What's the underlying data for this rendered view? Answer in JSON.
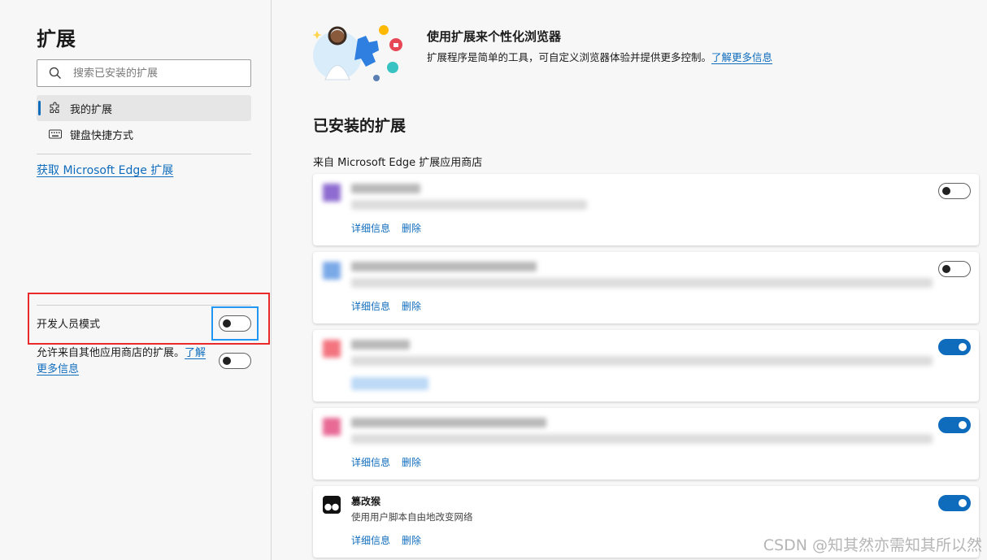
{
  "sidebar": {
    "title": "扩展",
    "search_placeholder": "搜索已安装的扩展",
    "nav": [
      {
        "label": "我的扩展",
        "icon": "puzzle-icon",
        "active": true
      },
      {
        "label": "键盘快捷方式",
        "icon": "keyboard-icon",
        "active": false
      }
    ],
    "store_link": "获取 Microsoft Edge 扩展",
    "developer_mode_label": "开发人员模式",
    "developer_mode_on": false,
    "allow_other_stores_text": "允许来自其他应用商店的扩展。",
    "allow_other_stores_link": "了解更多信息",
    "allow_other_stores_on": false
  },
  "hero": {
    "title": "使用扩展来个性化浏览器",
    "description": "扩展程序是简单的工具，可自定义浏览器体验并提供更多控制。",
    "learn_more": "了解更多信息"
  },
  "installed": {
    "section_title": "已安装的扩展",
    "source_label": "来自 Microsoft Edge 扩展应用商店",
    "details_label": "详细信息",
    "remove_label": "删除",
    "extensions": [
      {
        "name": "",
        "description": "",
        "enabled": false,
        "redacted": true,
        "icon_color": "#8e6bd0"
      },
      {
        "name": "",
        "description": "",
        "enabled": false,
        "redacted": true,
        "icon_color": "#7aa9e8"
      },
      {
        "name": "",
        "description": "",
        "enabled": true,
        "redacted": true,
        "icon_color": "#f3747f"
      },
      {
        "name": "",
        "description": "",
        "enabled": true,
        "redacted": true,
        "icon_color": "#e86a95"
      },
      {
        "name": "篡改猴",
        "description": "使用用户脚本自由地改变网络",
        "enabled": true,
        "redacted": false,
        "icon_color": "#111111"
      }
    ]
  },
  "watermark": "CSDN @知其然亦需知其所以然",
  "colors": {
    "accent": "#0f6cbd",
    "annotation_red": "#e82a2a",
    "annotation_blue": "#2196f3"
  }
}
